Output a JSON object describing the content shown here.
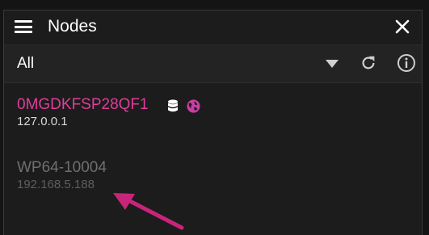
{
  "window": {
    "title": "Nodes"
  },
  "filter": {
    "selected": "All"
  },
  "nodes": [
    {
      "name": "0MGDKFSP28QF1",
      "ip": "127.0.0.1",
      "status": "online",
      "icons": [
        "database-icon",
        "globe-icon"
      ]
    },
    {
      "name": "WP64-10004",
      "ip": "192.168.5.188",
      "status": "offline"
    }
  ],
  "colors": {
    "accent": "#e23c9a",
    "panel_bg": "#1c1c1c",
    "toolbar_bg": "#232323",
    "offline_text": "#6f6f6f"
  }
}
